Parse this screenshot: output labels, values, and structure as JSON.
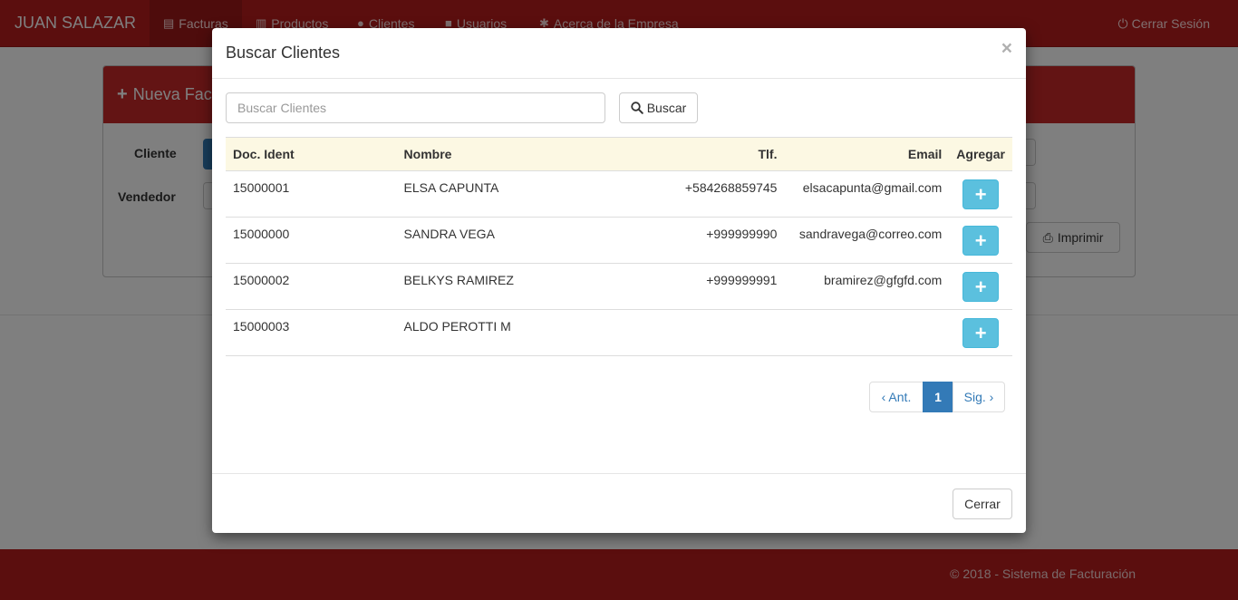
{
  "navbar": {
    "brand": "JUAN SALAZAR",
    "items": [
      {
        "label": "Facturas",
        "icon": "list-icon"
      },
      {
        "label": "Productos",
        "icon": "barcode-icon"
      },
      {
        "label": "Clientes",
        "icon": "user-icon"
      },
      {
        "label": "Usuarios",
        "icon": "lock-icon"
      },
      {
        "label": "Acerca de la Empresa",
        "icon": "gear-icon"
      }
    ],
    "logout": "Cerrar Sesión"
  },
  "panel": {
    "title": "Nueva Fac",
    "cliente_label": "Cliente",
    "vendedor_label": "Vendedor",
    "print_label": "Imprimir"
  },
  "footer": {
    "text": "© 2018 - Sistema de Facturación"
  },
  "modal": {
    "title": "Buscar Clientes",
    "close_symbol": "×",
    "search": {
      "placeholder": "Buscar Clientes",
      "value": "",
      "button_label": "Buscar"
    },
    "table": {
      "headers": [
        "Doc. Ident",
        "Nombre",
        "Tlf.",
        "Email",
        "Agregar"
      ],
      "rows": [
        {
          "doc": "15000001",
          "nombre": "ELSA CAPUNTA",
          "tlf": "+584268859745",
          "email": "elsacapunta@gmail.com"
        },
        {
          "doc": "15000000",
          "nombre": "SANDRA VEGA",
          "tlf": "+999999990",
          "email": "sandravega@correo.com"
        },
        {
          "doc": "15000002",
          "nombre": "BELKYS RAMIREZ",
          "tlf": "+999999991",
          "email": "bramirez@gfgfd.com"
        },
        {
          "doc": "15000003",
          "nombre": "ALDO PEROTTI M",
          "tlf": "",
          "email": ""
        }
      ],
      "add_symbol": "+"
    },
    "pagination": {
      "prev": "‹ Ant.",
      "current": "1",
      "next": "Sig. ›"
    },
    "footer_button": "Cerrar"
  },
  "colors": {
    "navbar": "#b71c1c",
    "panel_header": "#c62828",
    "info_button": "#5bc0de",
    "primary": "#337ab7",
    "table_header": "#fcf8e3"
  }
}
